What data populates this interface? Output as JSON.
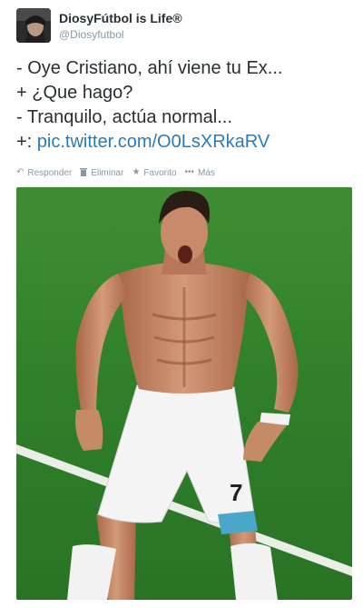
{
  "tweet": {
    "display_name": "DiosyFútbol is Life®",
    "handle": "@Diosyfutbol",
    "lines": [
      "- Oye Cristiano, ahí viene tu Ex...",
      "+ ¿Que hago?",
      "- Tranquilo, actúa normal..."
    ],
    "last_line_prefix": "+: ",
    "link_text": "pic.twitter.com/O0LsXRkaRV"
  },
  "actions": {
    "reply": "Responder",
    "delete": "Eliminar",
    "favorite": "Favorito",
    "more": "Más"
  },
  "colors": {
    "link": "#2b7bb9",
    "muted": "#8899a6",
    "text": "#292f33",
    "pitch": "#2f8a2e"
  },
  "icons": [
    "reply-icon",
    "trash-icon",
    "star-icon",
    "more-dots-icon"
  ]
}
